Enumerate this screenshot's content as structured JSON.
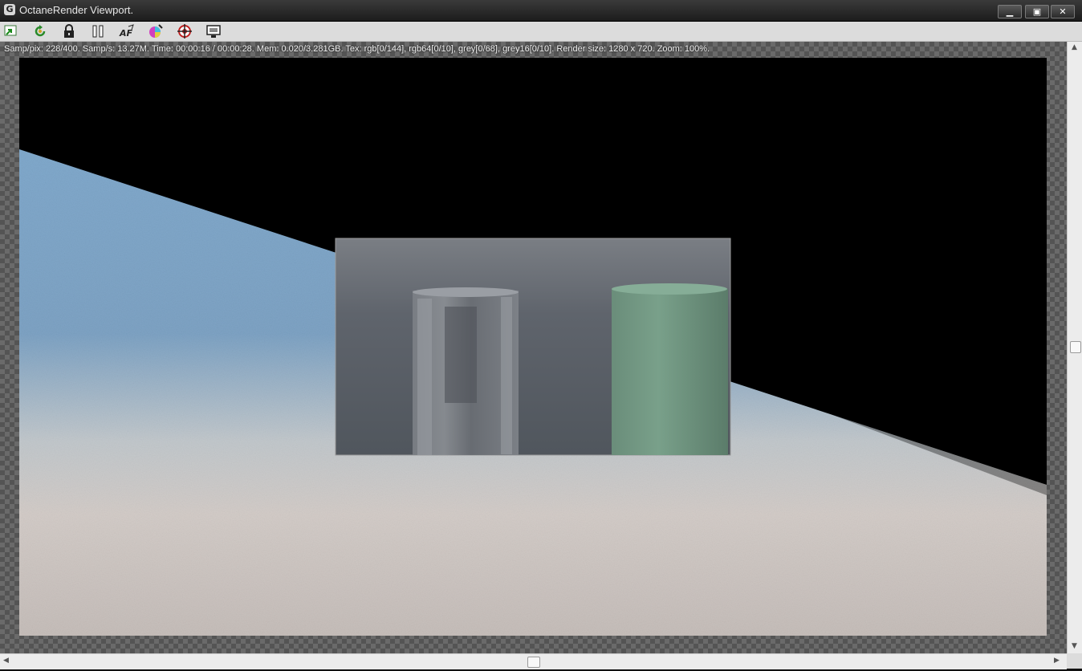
{
  "window": {
    "title": "OctaneRender Viewport.",
    "app_icon": "octane-logo-icon",
    "controls": {
      "minimize": "▁",
      "maximize": "▣",
      "close": "✕"
    }
  },
  "toolbar": {
    "tools": [
      {
        "name": "send-scene-icon"
      },
      {
        "name": "restart-render-icon"
      },
      {
        "name": "lock-icon"
      },
      {
        "name": "pause-icon"
      },
      {
        "name": "auto-focus-icon"
      },
      {
        "name": "color-picker-icon"
      },
      {
        "name": "region-target-icon"
      },
      {
        "name": "display-settings-icon"
      }
    ]
  },
  "status": {
    "text": "Samp/pix: 228/400.   Samp/s: 13.27M.   Time: 00:00:16 / 00:00:28.   Mem: 0.020/3.281GB.   Tex: rgb[0/144], rgb64[0/10], grey[0/68], grey16[0/10].   Render size: 1280 x 720.   Zoom: 100%."
  },
  "colors": {
    "sky": "#7fa6c8",
    "floor": "#d2cbc7",
    "green_cylinder": "#6f9581",
    "region_bg": "#5b6068"
  }
}
